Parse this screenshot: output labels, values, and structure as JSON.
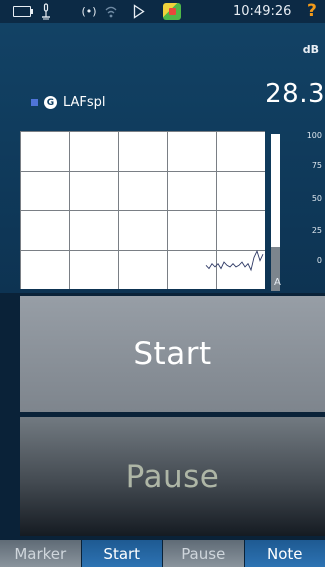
{
  "status_bar": {
    "icons": [
      "battery-icon",
      "microphone-icon",
      "signal-icon",
      "wifi-icon",
      "play-icon",
      "app-icon"
    ],
    "time": "10:49:26",
    "help_glyph": "?",
    "help_color": "#f29a1a"
  },
  "meter": {
    "unit": "dB",
    "value": "28.3",
    "measurement_label": "LAFspl",
    "weighting_glyph": "G",
    "series_color": "#4f74d8"
  },
  "chart_data": {
    "type": "line",
    "ylim": [
      0,
      100
    ],
    "series": [
      {
        "values": [
          15,
          13,
          16,
          14,
          16,
          13,
          17,
          15,
          14,
          16,
          14,
          15,
          17,
          14,
          16,
          12,
          20,
          24,
          18,
          22
        ]
      }
    ],
    "bar": {
      "label": "A",
      "ticks": [
        "100",
        "75",
        "50",
        "25",
        "0"
      ],
      "level": 28.3
    }
  },
  "buttons": {
    "start_label": "Start",
    "pause_label": "Pause"
  },
  "softkeys": [
    {
      "label": "Marker",
      "active": false
    },
    {
      "label": "Start",
      "active": true
    },
    {
      "label": "Pause",
      "active": false
    },
    {
      "label": "Note",
      "active": true
    }
  ]
}
